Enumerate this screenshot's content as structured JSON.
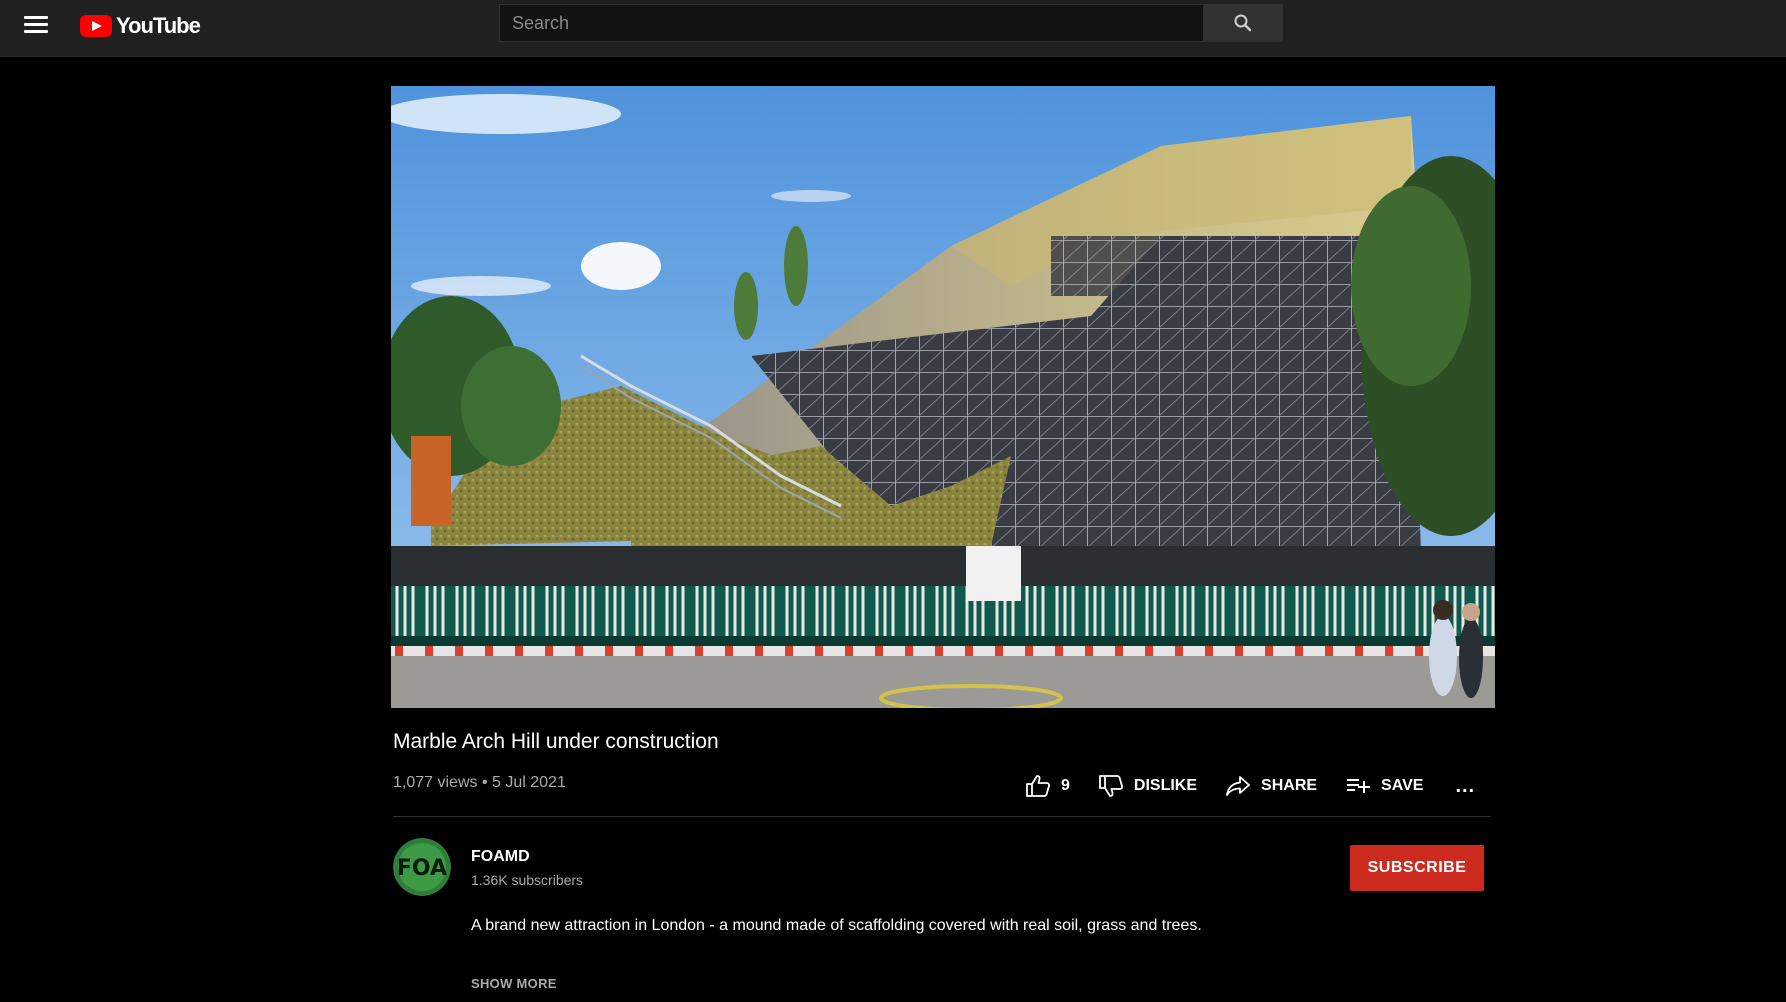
{
  "header": {
    "logo_text": "YouTube",
    "search_placeholder": "Search",
    "icons": [
      "menu-icon",
      "youtube-logo-icon",
      "search-icon"
    ]
  },
  "video": {
    "title": "Marble Arch Hill under construction",
    "views": "1,077 views",
    "date": "5 Jul 2021"
  },
  "actions": {
    "like_count": "9",
    "dislike_label": "DISLIKE",
    "share_label": "SHARE",
    "save_label": "SAVE",
    "more_label": "..."
  },
  "channel": {
    "name": "FOAMD",
    "subscribers": "1.36K subscribers",
    "avatar_text": "FOA",
    "subscribe_label": "SUBSCRIBE"
  },
  "description": {
    "text": "A brand new attraction in London - a mound made of scaffolding covered with real soil, grass and trees.",
    "show_more_label": "SHOW MORE"
  },
  "colors": {
    "background": "#000000",
    "topbar": "#202020",
    "subscribe": "#cc2a1e",
    "brand_red": "#ff0000",
    "secondary_text": "#aaaaaa"
  }
}
